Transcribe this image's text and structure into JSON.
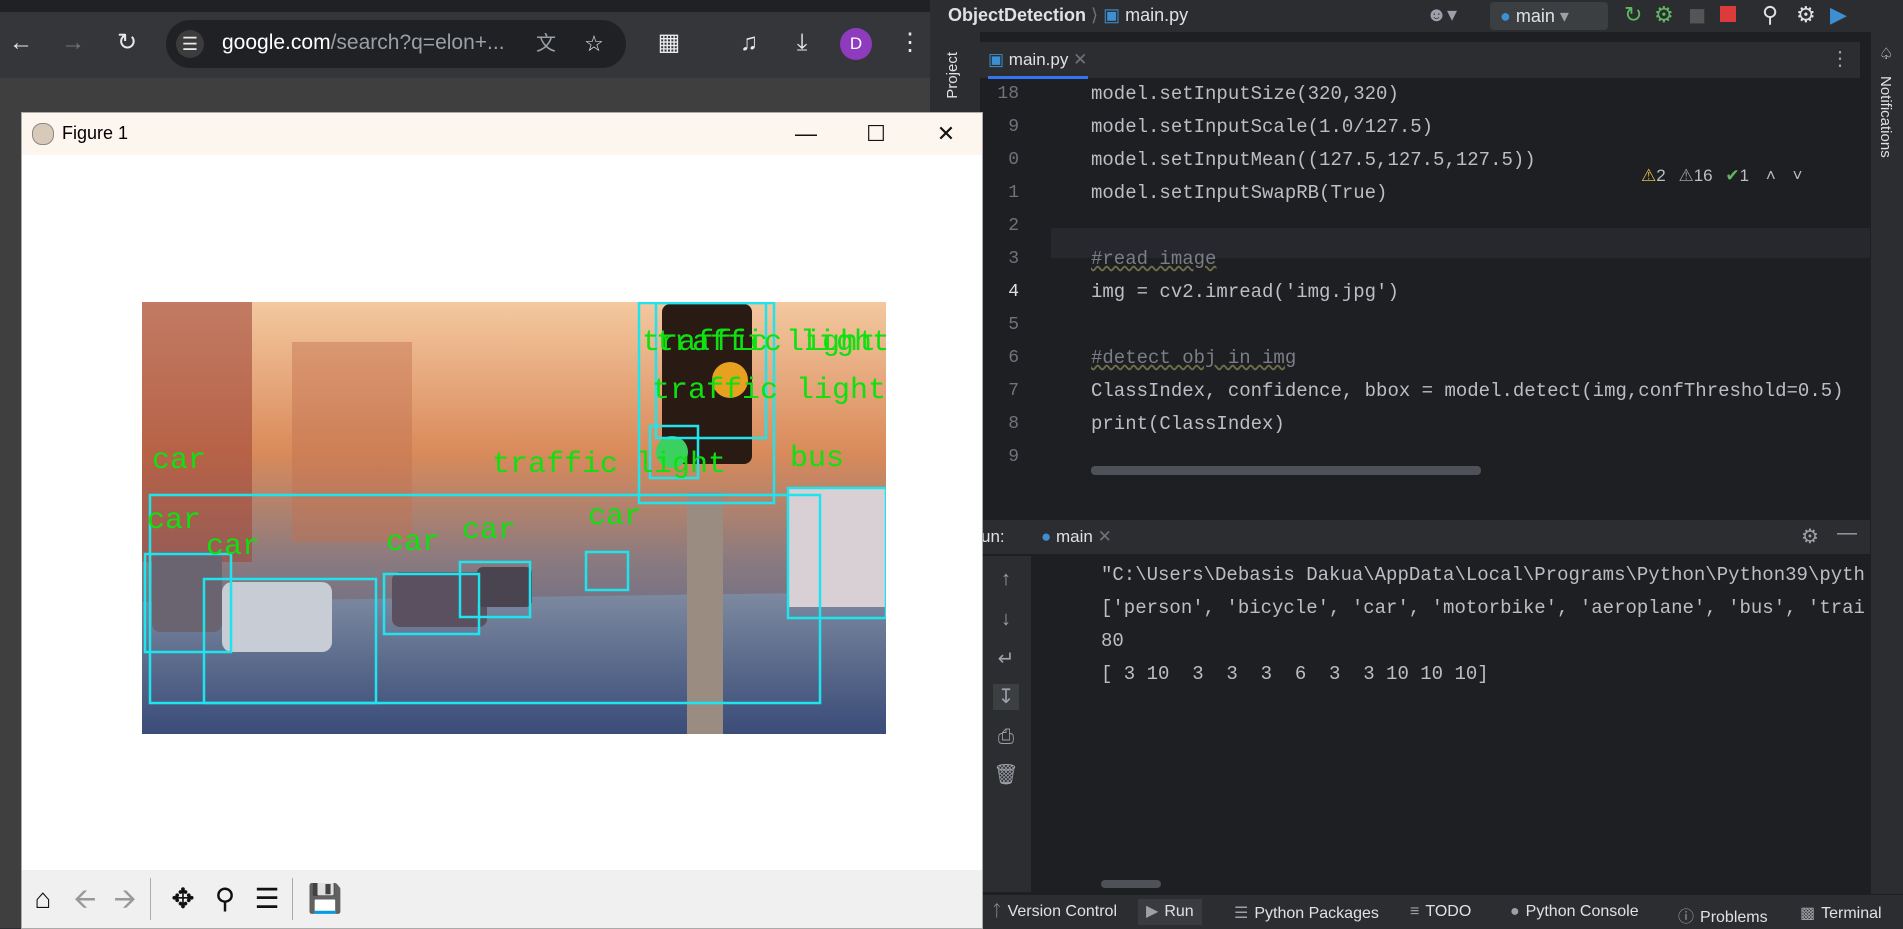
{
  "browser": {
    "url_host": "google.com",
    "url_rest": "/search?q=elon+...",
    "profile_initial": "D",
    "icons": [
      "back-arrow-icon",
      "forward-arrow-icon",
      "reload-icon",
      "site-info-icon",
      "translate-icon",
      "star-icon",
      "extensions-icon",
      "media-icon",
      "download-icon",
      "menu-dots-icon"
    ]
  },
  "figure": {
    "title": "Figure 1",
    "toolbar_icons": [
      "home-icon",
      "back-icon",
      "forward-icon",
      "pan-icon",
      "zoom-icon",
      "configure-icon",
      "save-icon"
    ],
    "detections": [
      {
        "label": "traffic light"
      },
      {
        "label": "traffic light"
      },
      {
        "label": "traffic light"
      },
      {
        "label": "traffic light"
      },
      {
        "label": "bus"
      },
      {
        "label": "car"
      },
      {
        "label": "car"
      },
      {
        "label": "car"
      },
      {
        "label": "car"
      },
      {
        "label": "car"
      },
      {
        "label": "car"
      }
    ]
  },
  "ide": {
    "project": "ObjectDetection",
    "file": "main.py",
    "branch": "main",
    "tab": "main.py",
    "inspections": {
      "warnings": "2",
      "weak": "16",
      "ok": "1"
    },
    "side_labels": {
      "left": "Project",
      "right": "Notifications"
    },
    "code": [
      {
        "ln": "18",
        "text": "model.setInputSize(320,320)"
      },
      {
        "ln": "9",
        "text": "model.setInputScale(1.0/127.5)"
      },
      {
        "ln": "0",
        "text": "model.setInputMean((127.5,127.5,127.5))"
      },
      {
        "ln": "1",
        "text": "model.setInputSwapRB(True)"
      },
      {
        "ln": "2",
        "text": ""
      },
      {
        "ln": "3",
        "text": "#read image"
      },
      {
        "ln": "4",
        "text": "img = cv2.imread('img.jpg')"
      },
      {
        "ln": "5",
        "text": ""
      },
      {
        "ln": "6",
        "text": "#detect obj in img"
      },
      {
        "ln": "7",
        "text": "ClassIndex, confidence, bbox = model.detect(img,confThreshold=0.5)"
      },
      {
        "ln": "8",
        "text": "print(ClassIndex)"
      },
      {
        "ln": "9",
        "text": ""
      }
    ],
    "run": {
      "label": "un:",
      "tab": "main",
      "output": [
        "\"C:\\Users\\Debasis Dakua\\AppData\\Local\\Programs\\Python\\Python39\\pyth",
        "['person', 'bicycle', 'car', 'motorbike', 'aeroplane', 'bus', 'trai",
        "80",
        "[ 3 10  3  3  3  6  3  3 10 10 10]"
      ]
    },
    "statusbar": [
      "Version Control",
      "Run",
      "Python Packages",
      "TODO",
      "Python Console",
      "Problems",
      "Terminal"
    ]
  }
}
